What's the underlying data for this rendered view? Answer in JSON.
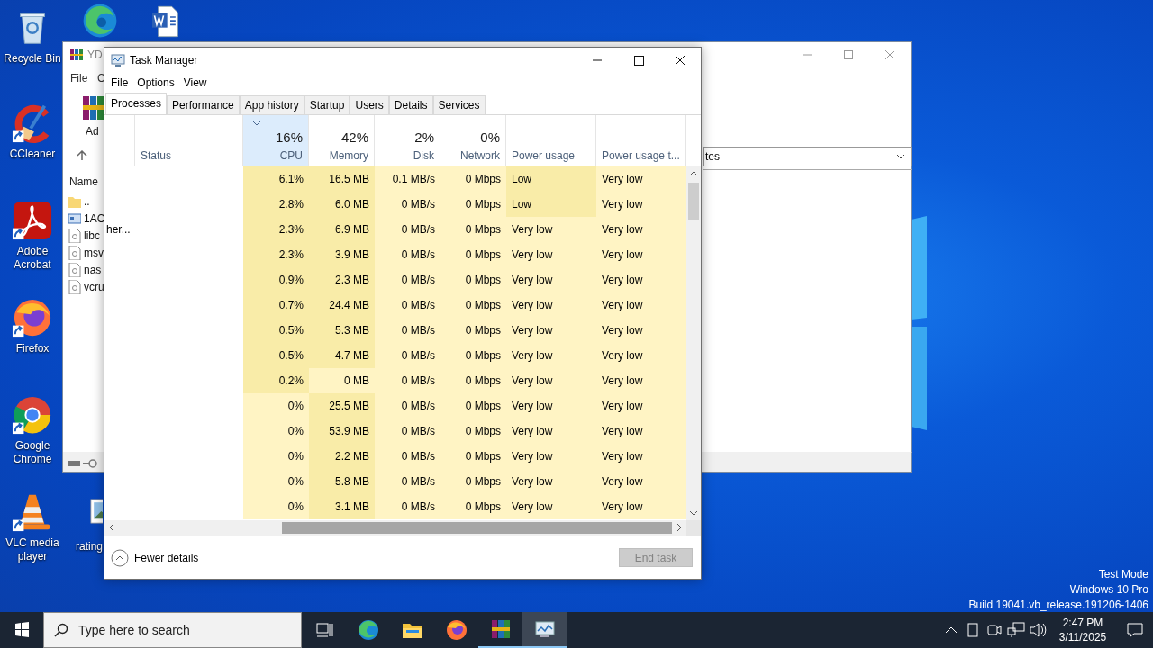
{
  "desktop": {
    "icons": [
      {
        "kind": "recycle-bin",
        "label": "Recycle Bin",
        "shortcut": false
      },
      {
        "kind": "edge",
        "shortcut": false
      },
      {
        "kind": "word",
        "shortcut": false
      },
      {
        "kind": "ccleaner",
        "label": "CCleaner",
        "shortcut": true
      },
      {
        "kind": "acrobat",
        "label": "Adobe Acrobat",
        "shortcut": true
      },
      {
        "kind": "firefox",
        "label": "Firefox",
        "shortcut": true
      },
      {
        "kind": "chrome",
        "label": "Google Chrome",
        "shortcut": true
      },
      {
        "kind": "vlc",
        "label": "VLC media player",
        "shortcut": true
      },
      {
        "kind": "image-file",
        "label": "rating",
        "shortcut": false
      }
    ],
    "system_notice": [
      "Test Mode",
      "Windows 10 Pro",
      "Build 19041.vb_release.191206-1406"
    ]
  },
  "archive_window": {
    "title": "YD",
    "menu": [
      "File",
      "C"
    ],
    "toolbar": [
      "Ad"
    ],
    "address": "tes",
    "list_header": "Name",
    "files": [
      {
        "kind": "folder",
        "name": ".."
      },
      {
        "kind": "app",
        "name": "1AC"
      },
      {
        "kind": "file",
        "name": "libc"
      },
      {
        "kind": "file",
        "name": "msv"
      },
      {
        "kind": "file",
        "name": "nas"
      },
      {
        "kind": "file",
        "name": "vcru"
      }
    ]
  },
  "task_manager": {
    "title": "Task Manager",
    "menu": [
      "File",
      "Options",
      "View"
    ],
    "tabs": [
      {
        "label": "Processes",
        "selected": true
      },
      {
        "label": "Performance",
        "selected": false
      },
      {
        "label": "App history",
        "selected": false
      },
      {
        "label": "Startup",
        "selected": false
      },
      {
        "label": "Users",
        "selected": false
      },
      {
        "label": "Details",
        "selected": false
      },
      {
        "label": "Services",
        "selected": false
      }
    ],
    "columns": [
      {
        "kind": "status",
        "label": "Status",
        "sorted": false
      },
      {
        "kind": "numeric",
        "percent": "16%",
        "label": "CPU",
        "sorted": true
      },
      {
        "kind": "numeric",
        "percent": "42%",
        "label": "Memory",
        "sorted": false
      },
      {
        "kind": "numeric",
        "percent": "2%",
        "label": "Disk",
        "sorted": false
      },
      {
        "kind": "numeric",
        "percent": "0%",
        "label": "Network",
        "sorted": false
      },
      {
        "kind": "text",
        "label": "Power usage",
        "sorted": false
      },
      {
        "kind": "text",
        "label": "Power usage t...",
        "sorted": false
      }
    ],
    "rows": [
      {
        "cells": [
          {
            "text": ""
          },
          {
            "text": "6.1%",
            "color": "#f9eca8"
          },
          {
            "text": "16.5 MB",
            "color": "#f9eca8"
          },
          {
            "text": "0.1 MB/s",
            "color": "#fff4c4"
          },
          {
            "text": "0 Mbps",
            "color": "#fff4c4"
          },
          {
            "text": "Low",
            "color": "#f9eca8"
          },
          {
            "text": "Very low",
            "color": "#fff4c4"
          }
        ]
      },
      {
        "cells": [
          {
            "text": ""
          },
          {
            "text": "2.8%",
            "color": "#f9eca8"
          },
          {
            "text": "6.0 MB",
            "color": "#f9eca8"
          },
          {
            "text": "0 MB/s",
            "color": "#fff4c4"
          },
          {
            "text": "0 Mbps",
            "color": "#fff4c4"
          },
          {
            "text": "Low",
            "color": "#f9eca8"
          },
          {
            "text": "Very low",
            "color": "#fff4c4"
          }
        ]
      },
      {
        "name": "her...",
        "cells": [
          {
            "text": ""
          },
          {
            "text": "2.3%",
            "color": "#f9eca8"
          },
          {
            "text": "6.9 MB",
            "color": "#f9eca8"
          },
          {
            "text": "0 MB/s",
            "color": "#fff4c4"
          },
          {
            "text": "0 Mbps",
            "color": "#fff4c4"
          },
          {
            "text": "Very low",
            "color": "#fff4c4"
          },
          {
            "text": "Very low",
            "color": "#fff4c4"
          }
        ]
      },
      {
        "cells": [
          {
            "text": ""
          },
          {
            "text": "2.3%",
            "color": "#f9eca8"
          },
          {
            "text": "3.9 MB",
            "color": "#f9eca8"
          },
          {
            "text": "0 MB/s",
            "color": "#fff4c4"
          },
          {
            "text": "0 Mbps",
            "color": "#fff4c4"
          },
          {
            "text": "Very low",
            "color": "#fff4c4"
          },
          {
            "text": "Very low",
            "color": "#fff4c4"
          }
        ]
      },
      {
        "cells": [
          {
            "text": ""
          },
          {
            "text": "0.9%",
            "color": "#f9eca8"
          },
          {
            "text": "2.3 MB",
            "color": "#f9eca8"
          },
          {
            "text": "0 MB/s",
            "color": "#fff4c4"
          },
          {
            "text": "0 Mbps",
            "color": "#fff4c4"
          },
          {
            "text": "Very low",
            "color": "#fff4c4"
          },
          {
            "text": "Very low",
            "color": "#fff4c4"
          }
        ]
      },
      {
        "cells": [
          {
            "text": ""
          },
          {
            "text": "0.7%",
            "color": "#f9eca8"
          },
          {
            "text": "24.4 MB",
            "color": "#f9eca8"
          },
          {
            "text": "0 MB/s",
            "color": "#fff4c4"
          },
          {
            "text": "0 Mbps",
            "color": "#fff4c4"
          },
          {
            "text": "Very low",
            "color": "#fff4c4"
          },
          {
            "text": "Very low",
            "color": "#fff4c4"
          }
        ]
      },
      {
        "cells": [
          {
            "text": ""
          },
          {
            "text": "0.5%",
            "color": "#f9eca8"
          },
          {
            "text": "5.3 MB",
            "color": "#f9eca8"
          },
          {
            "text": "0 MB/s",
            "color": "#fff4c4"
          },
          {
            "text": "0 Mbps",
            "color": "#fff4c4"
          },
          {
            "text": "Very low",
            "color": "#fff4c4"
          },
          {
            "text": "Very low",
            "color": "#fff4c4"
          }
        ]
      },
      {
        "cells": [
          {
            "text": ""
          },
          {
            "text": "0.5%",
            "color": "#f9eca8"
          },
          {
            "text": "4.7 MB",
            "color": "#f9eca8"
          },
          {
            "text": "0 MB/s",
            "color": "#fff4c4"
          },
          {
            "text": "0 Mbps",
            "color": "#fff4c4"
          },
          {
            "text": "Very low",
            "color": "#fff4c4"
          },
          {
            "text": "Very low",
            "color": "#fff4c4"
          }
        ]
      },
      {
        "cells": [
          {
            "text": ""
          },
          {
            "text": "0.2%",
            "color": "#f9eca8"
          },
          {
            "text": "0 MB",
            "color": "#fff4c4"
          },
          {
            "text": "0 MB/s",
            "color": "#fff4c4"
          },
          {
            "text": "0 Mbps",
            "color": "#fff4c4"
          },
          {
            "text": "Very low",
            "color": "#fff4c4"
          },
          {
            "text": "Very low",
            "color": "#fff4c4"
          }
        ]
      },
      {
        "cells": [
          {
            "text": ""
          },
          {
            "text": "0%",
            "color": "#fff4c4"
          },
          {
            "text": "25.5 MB",
            "color": "#f9eca8"
          },
          {
            "text": "0 MB/s",
            "color": "#fff4c4"
          },
          {
            "text": "0 Mbps",
            "color": "#fff4c4"
          },
          {
            "text": "Very low",
            "color": "#fff4c4"
          },
          {
            "text": "Very low",
            "color": "#fff4c4"
          }
        ]
      },
      {
        "cells": [
          {
            "text": ""
          },
          {
            "text": "0%",
            "color": "#fff4c4"
          },
          {
            "text": "53.9 MB",
            "color": "#f9eca8"
          },
          {
            "text": "0 MB/s",
            "color": "#fff4c4"
          },
          {
            "text": "0 Mbps",
            "color": "#fff4c4"
          },
          {
            "text": "Very low",
            "color": "#fff4c4"
          },
          {
            "text": "Very low",
            "color": "#fff4c4"
          }
        ]
      },
      {
        "cells": [
          {
            "text": ""
          },
          {
            "text": "0%",
            "color": "#fff4c4"
          },
          {
            "text": "2.2 MB",
            "color": "#f9eca8"
          },
          {
            "text": "0 MB/s",
            "color": "#fff4c4"
          },
          {
            "text": "0 Mbps",
            "color": "#fff4c4"
          },
          {
            "text": "Very low",
            "color": "#fff4c4"
          },
          {
            "text": "Very low",
            "color": "#fff4c4"
          }
        ]
      },
      {
        "cells": [
          {
            "text": ""
          },
          {
            "text": "0%",
            "color": "#fff4c4"
          },
          {
            "text": "5.8 MB",
            "color": "#f9eca8"
          },
          {
            "text": "0 MB/s",
            "color": "#fff4c4"
          },
          {
            "text": "0 Mbps",
            "color": "#fff4c4"
          },
          {
            "text": "Very low",
            "color": "#fff4c4"
          },
          {
            "text": "Very low",
            "color": "#fff4c4"
          }
        ]
      },
      {
        "cells": [
          {
            "text": ""
          },
          {
            "text": "0%",
            "color": "#fff4c4"
          },
          {
            "text": "3.1 MB",
            "color": "#f9eca8"
          },
          {
            "text": "0 MB/s",
            "color": "#fff4c4"
          },
          {
            "text": "0 Mbps",
            "color": "#fff4c4"
          },
          {
            "text": "Very low",
            "color": "#fff4c4"
          },
          {
            "text": "Very low",
            "color": "#fff4c4"
          }
        ]
      }
    ],
    "fewer_details": "Fewer details",
    "end_task": {
      "label": "End task",
      "disabled": true
    }
  },
  "taskbar": {
    "search_placeholder": "Type here to search",
    "apps": [
      {
        "kind": "edge",
        "running": false,
        "selected": false
      },
      {
        "kind": "explorer",
        "running": false,
        "selected": false
      },
      {
        "kind": "firefox",
        "running": false,
        "selected": false
      },
      {
        "kind": "winrar",
        "running": true,
        "selected": false
      },
      {
        "kind": "task-manager",
        "running": true,
        "selected": true
      }
    ],
    "clock": {
      "time": "2:47 PM",
      "date": "3/11/2025"
    }
  }
}
